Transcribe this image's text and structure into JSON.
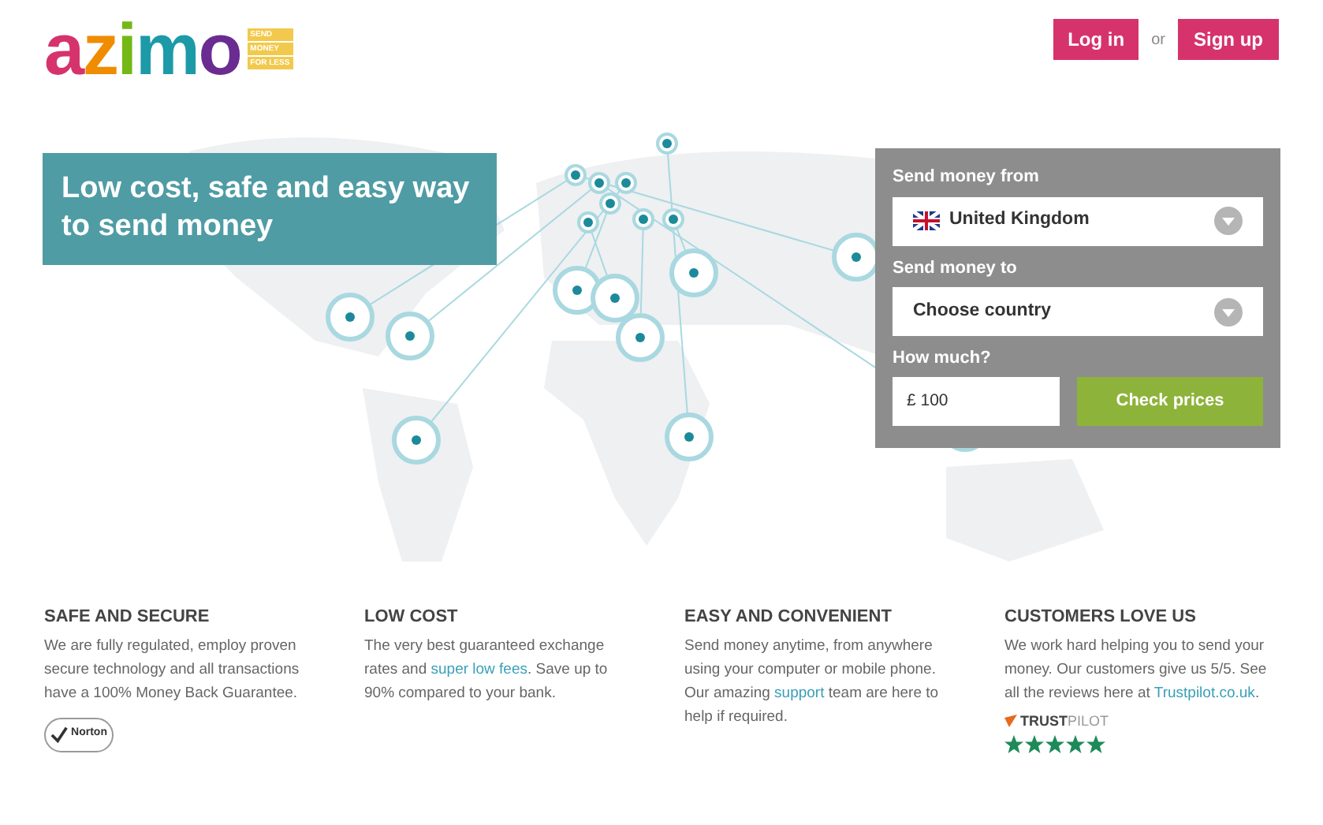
{
  "header": {
    "logo": {
      "text": "azimo",
      "tagline": [
        "SEND",
        "MONEY",
        "FOR LESS"
      ]
    },
    "login": "Log in",
    "or": "or",
    "signup": "Sign up"
  },
  "hero": {
    "headline": "Low cost, safe and easy way to send money"
  },
  "form": {
    "from_label": "Send money from",
    "from_value": "United Kingdom",
    "to_label": "Send money to",
    "to_value": "Choose country",
    "amount_label": "How much?",
    "amount_value": "£ 100",
    "submit": "Check prices"
  },
  "features": [
    {
      "title": "SAFE AND SECURE",
      "before": "We are fully regulated, employ proven secure technology and all transactions have a 100% Money Back Guarantee.",
      "kind": "norton",
      "badge": "Norton"
    },
    {
      "title": "LOW COST",
      "before": "The very best guaranteed exchange rates and ",
      "link": "super low fees",
      "after": ". Save up to 90% compared to your bank."
    },
    {
      "title": "EASY AND CONVENIENT",
      "before": "Send money anytime, from anywhere using your computer or mobile phone. Our amazing ",
      "link": "support",
      "after": " team are here to help if required."
    },
    {
      "title": "CUSTOMERS LOVE US",
      "before": "We work hard helping you to send your money. Our customers give us 5/5. See all the reviews here at ",
      "link": "Trustpilot.co.uk",
      "after": ".",
      "kind": "trustpilot",
      "brand_bold": "TRUST",
      "brand_light": "PILOT",
      "stars": 5
    }
  ]
}
